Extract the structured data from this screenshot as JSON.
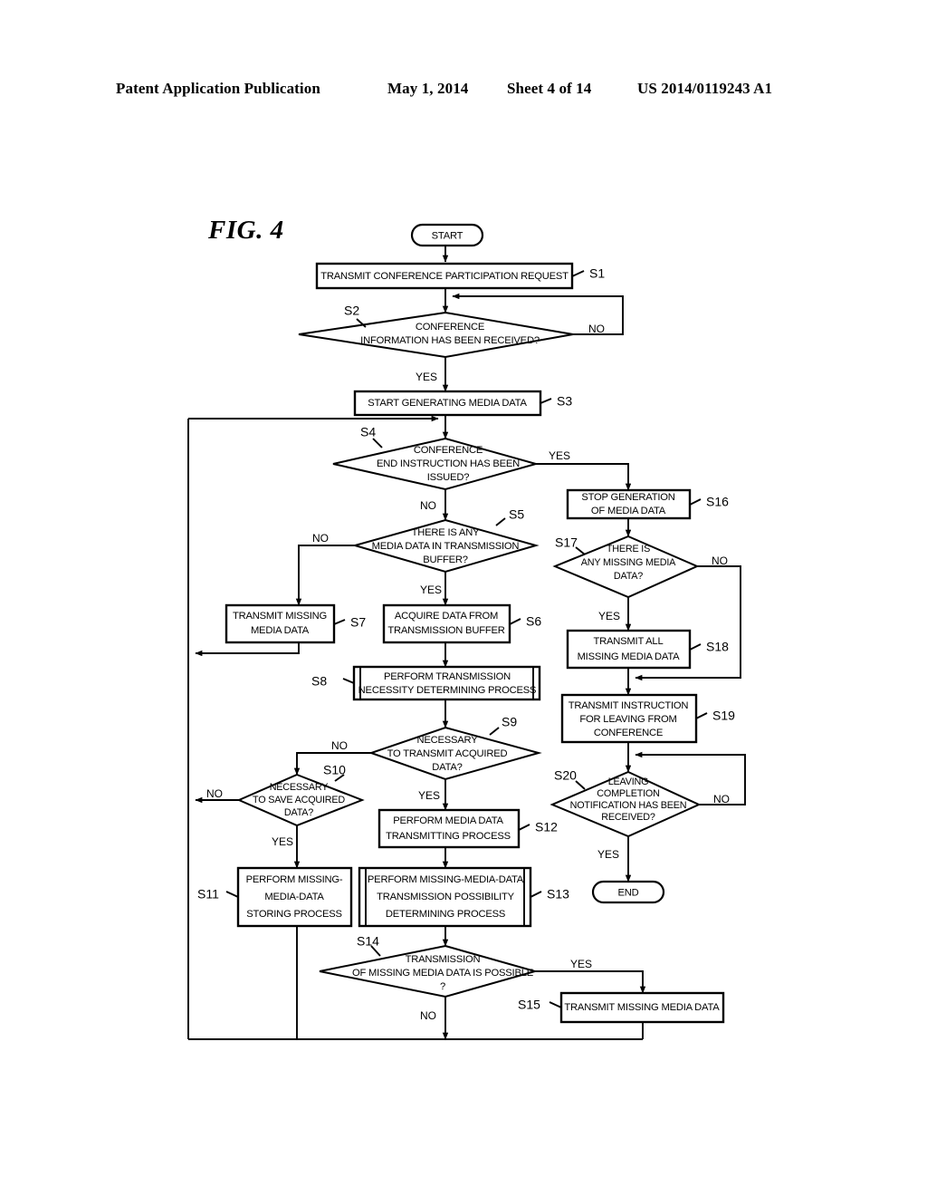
{
  "header": {
    "publication": "Patent Application Publication",
    "date": "May 1, 2014",
    "sheet": "Sheet 4 of 14",
    "number": "US 2014/0119243 A1"
  },
  "figure": {
    "label": "FIG. 4"
  },
  "flowchart": {
    "type": "flowchart",
    "nodes": [
      {
        "id": "start",
        "shape": "terminator",
        "step": "",
        "lines": [
          "START"
        ]
      },
      {
        "id": "s1",
        "shape": "process",
        "step": "S1",
        "lines": [
          "TRANSMIT CONFERENCE PARTICIPATION REQUEST"
        ]
      },
      {
        "id": "s2",
        "shape": "decision",
        "step": "S2",
        "lines": [
          "CONFERENCE",
          "INFORMATION HAS BEEN RECEIVED?"
        ]
      },
      {
        "id": "s3",
        "shape": "process",
        "step": "S3",
        "lines": [
          "START GENERATING MEDIA DATA"
        ]
      },
      {
        "id": "s4",
        "shape": "decision",
        "step": "S4",
        "lines": [
          "CONFERENCE",
          "END INSTRUCTION HAS BEEN",
          "ISSUED?"
        ]
      },
      {
        "id": "s5",
        "shape": "decision",
        "step": "S5",
        "lines": [
          "THERE IS ANY",
          "MEDIA DATA IN TRANSMISSION",
          "BUFFER?"
        ]
      },
      {
        "id": "s6",
        "shape": "process",
        "step": "S6",
        "lines": [
          "ACQUIRE DATA FROM",
          "TRANSMISSION BUFFER"
        ]
      },
      {
        "id": "s7",
        "shape": "process",
        "step": "S7",
        "lines": [
          "TRANSMIT MISSING",
          "MEDIA DATA"
        ]
      },
      {
        "id": "s8",
        "shape": "predefined-process",
        "step": "S8",
        "lines": [
          "PERFORM TRANSMISSION",
          "NECESSITY DETERMINING PROCESS"
        ]
      },
      {
        "id": "s9",
        "shape": "decision",
        "step": "S9",
        "lines": [
          "NECESSARY",
          "TO TRANSMIT ACQUIRED",
          "DATA?"
        ]
      },
      {
        "id": "s10",
        "shape": "decision",
        "step": "S10",
        "lines": [
          "NECESSARY",
          "TO SAVE ACQUIRED",
          "DATA?"
        ]
      },
      {
        "id": "s11",
        "shape": "process",
        "step": "S11",
        "lines": [
          "PERFORM MISSING-",
          "MEDIA-DATA",
          "STORING PROCESS"
        ]
      },
      {
        "id": "s12",
        "shape": "process",
        "step": "S12",
        "lines": [
          "PERFORM MEDIA DATA",
          "TRANSMITTING PROCESS"
        ]
      },
      {
        "id": "s13",
        "shape": "predefined-process",
        "step": "S13",
        "lines": [
          "PERFORM MISSING-MEDIA-DATA",
          "TRANSMISSION POSSIBILITY",
          "DETERMINING PROCESS"
        ]
      },
      {
        "id": "s14",
        "shape": "decision",
        "step": "S14",
        "lines": [
          "TRANSMISSION",
          "OF MISSING MEDIA DATA IS POSSIBLE",
          "?"
        ]
      },
      {
        "id": "s15",
        "shape": "process",
        "step": "S15",
        "lines": [
          "TRANSMIT MISSING MEDIA DATA"
        ]
      },
      {
        "id": "s16",
        "shape": "process",
        "step": "S16",
        "lines": [
          "STOP GENERATION",
          "OF MEDIA DATA"
        ]
      },
      {
        "id": "s17",
        "shape": "decision",
        "step": "S17",
        "lines": [
          "THERE IS",
          "ANY MISSING MEDIA",
          "DATA?"
        ]
      },
      {
        "id": "s18",
        "shape": "process",
        "step": "S18",
        "lines": [
          "TRANSMIT ALL",
          "MISSING MEDIA DATA"
        ]
      },
      {
        "id": "s19",
        "shape": "process",
        "step": "S19",
        "lines": [
          "TRANSMIT INSTRUCTION",
          "FOR LEAVING FROM",
          "CONFERENCE"
        ]
      },
      {
        "id": "s20",
        "shape": "decision",
        "step": "S20",
        "lines": [
          "LEAVING",
          "COMPLETION",
          "NOTIFICATION HAS BEEN",
          "RECEIVED?"
        ]
      },
      {
        "id": "end",
        "shape": "terminator",
        "step": "",
        "lines": [
          "END"
        ]
      }
    ],
    "branch_labels": {
      "s2_no": "NO",
      "s2_yes": "YES",
      "s4_yes": "YES",
      "s4_no": "NO",
      "s5_no": "NO",
      "s5_yes": "YES",
      "s9_no": "NO",
      "s9_yes": "YES",
      "s10_no": "NO",
      "s10_yes": "YES",
      "s14_yes": "YES",
      "s14_no": "NO",
      "s17_no": "NO",
      "s17_yes": "YES",
      "s20_no": "NO",
      "s20_yes": "YES"
    }
  }
}
